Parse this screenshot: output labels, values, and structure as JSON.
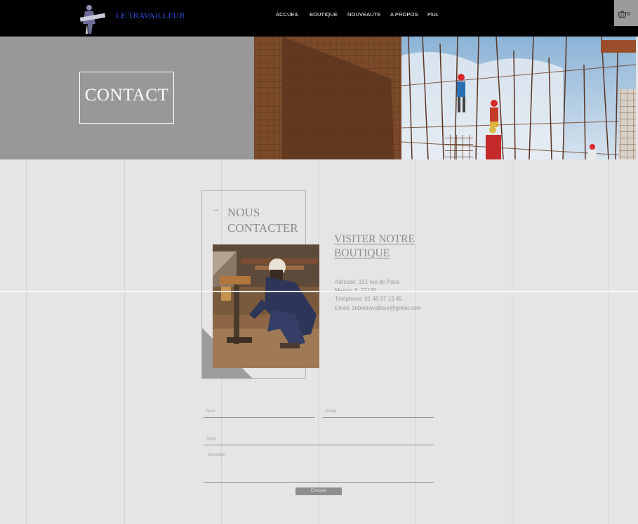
{
  "header": {
    "brand": "LE TRAVAILLEUR",
    "nav": [
      "ACCUEIL",
      "BOUTIQUE",
      "NOUVEAUTE",
      "A PROPOS",
      "Plus"
    ],
    "cart_count": "0"
  },
  "hero": {
    "title": "CONTACT"
  },
  "contact": {
    "arrow": "→",
    "heading_line1": "NOUS",
    "heading_line2": "CONTACTER",
    "visit_line1": "VISITER NOTRE",
    "visit_line2": "BOUTIQUE",
    "address": "Adresse: 151 rue de Paris",
    "city": "Meaux, IL 77100",
    "phone": "Téléphone: 01 48 97 13 45",
    "email": "Email: znbletravailleur@gmail.com"
  },
  "form": {
    "name_label": "Nom",
    "email_label": "Email",
    "subject_label": "Sujet",
    "message_label": "Message",
    "submit_label": "Envoyer"
  },
  "colors": {
    "header_bg": "#000000",
    "brand": "#2a4bd8",
    "page_bg": "#e6e4e5",
    "hero_left_bg": "#989898",
    "accent_gray": "#8e8e8e"
  }
}
